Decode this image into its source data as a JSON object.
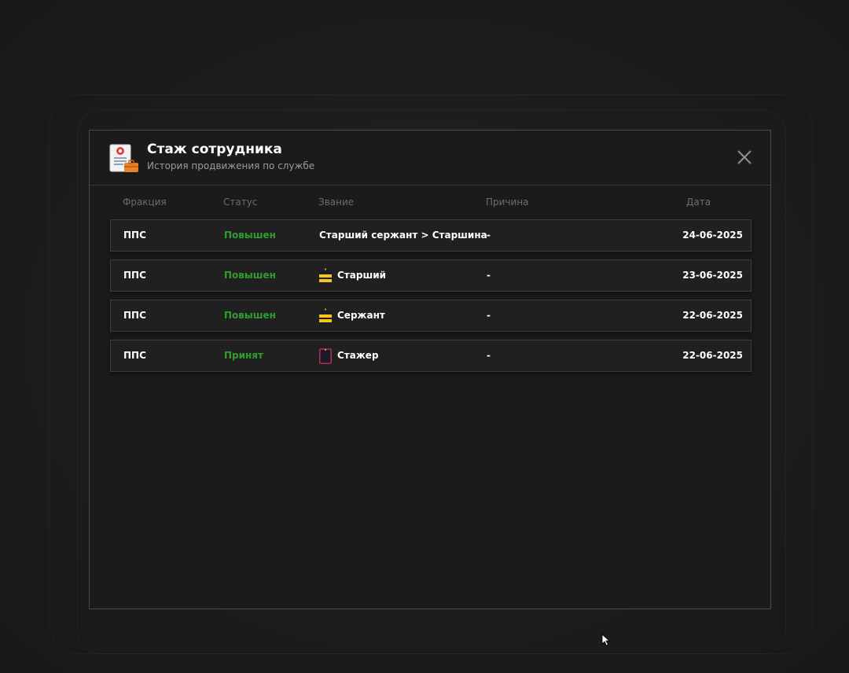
{
  "modal": {
    "title": "Стаж сотрудника",
    "subtitle": "История продвижения по службе",
    "header_icon": "certificate-icon",
    "close_icon": "close-icon"
  },
  "table": {
    "columns": [
      "Фракция",
      "Статус",
      "Звание",
      "Причина",
      "Дата"
    ],
    "rows": [
      {
        "faction": "ППС",
        "status": "Повышен",
        "rank": "Старший сержант > Старшина",
        "rank_icon": "",
        "reason": "-",
        "date": "24-06-2025"
      },
      {
        "faction": "ППС",
        "status": "Повышен",
        "rank": "Старший",
        "rank_icon": "yellow-stripes-rank-icon",
        "reason": "-",
        "date": "23-06-2025"
      },
      {
        "faction": "ППС",
        "status": "Повышен",
        "rank": "Сержант",
        "rank_icon": "yellow-stripes-rank-icon",
        "reason": "-",
        "date": "22-06-2025"
      },
      {
        "faction": "ППС",
        "status": "Принят",
        "rank": "Стажер",
        "rank_icon": "empty-shoulder-strap-rank-icon",
        "reason": "-",
        "date": "22-06-2025"
      }
    ]
  },
  "colors": {
    "status_green": "#2f9e2f",
    "rank_yellow": "#f5c518",
    "background": "#1b1b1b",
    "border": "#4a4a4a"
  }
}
